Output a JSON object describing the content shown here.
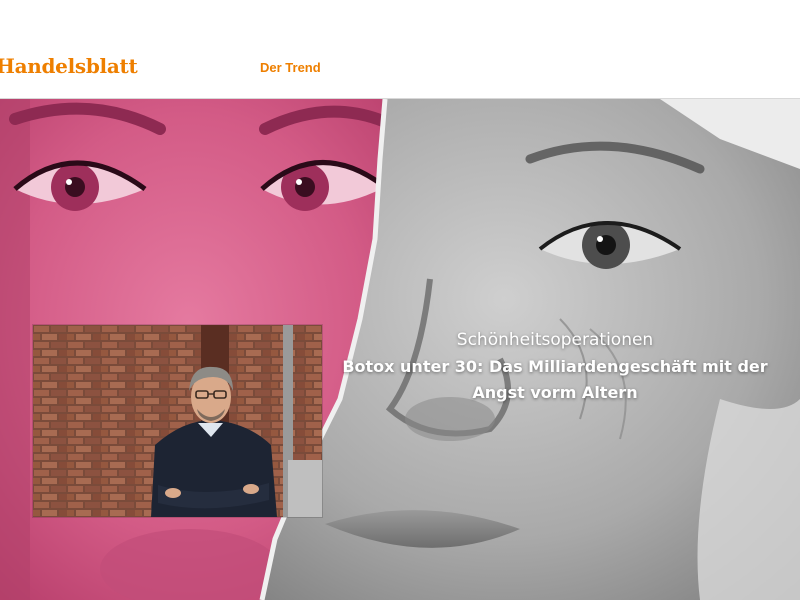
{
  "header": {
    "logo_text": "Handelsblatt",
    "nav_item": "Der Trend",
    "brand_color": "#ee7f00"
  },
  "hero": {
    "image_description_icon": "face-collage-image",
    "inset_photo_icon": "author-portrait-photo",
    "kicker": "Schönheitsoperationen",
    "title": "Botox unter 30: Das Milliardengeschäft mit der Angst vorm Altern",
    "colors": {
      "magenta": "#d0567f",
      "gray": "#9a9a9a"
    }
  }
}
